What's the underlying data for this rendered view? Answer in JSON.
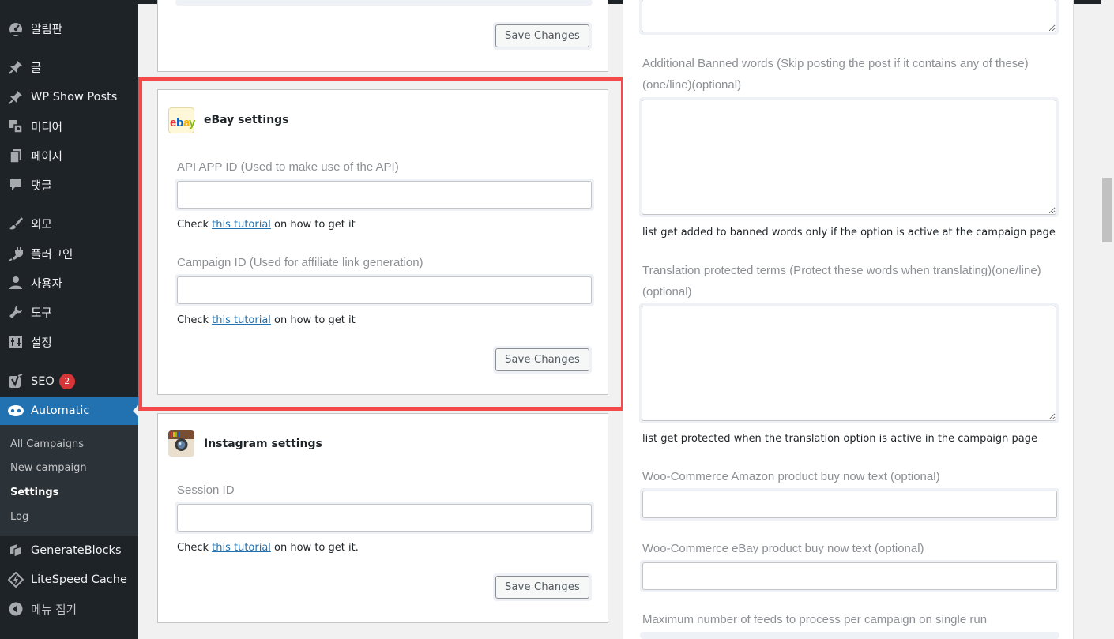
{
  "sidebar": {
    "items": [
      {
        "label": "알림판",
        "icon": "dashboard-icon"
      },
      {
        "label": "글",
        "icon": "pin-icon"
      },
      {
        "label": "WP Show Posts",
        "icon": "pin-icon"
      },
      {
        "label": "미디어",
        "icon": "media-icon"
      },
      {
        "label": "페이지",
        "icon": "page-icon"
      },
      {
        "label": "댓글",
        "icon": "comment-icon"
      },
      {
        "label": "외모",
        "icon": "brush-icon"
      },
      {
        "label": "플러그인",
        "icon": "plugin-icon"
      },
      {
        "label": "사용자",
        "icon": "user-icon"
      },
      {
        "label": "도구",
        "icon": "wrench-icon"
      },
      {
        "label": "설정",
        "icon": "settings-icon"
      },
      {
        "label": "SEO",
        "icon": "yoast-icon",
        "badge": "2"
      },
      {
        "label": "Automatic",
        "icon": "automatic-icon",
        "active": true
      },
      {
        "label": "GenerateBlocks",
        "icon": "generateblocks-icon"
      },
      {
        "label": "LiteSpeed Cache",
        "icon": "litespeed-icon"
      },
      {
        "label": "메뉴 접기",
        "icon": "collapse-icon"
      }
    ],
    "submenu": [
      "All Campaigns",
      "New campaign",
      "Settings",
      "Log"
    ]
  },
  "top_panel": {
    "save_label": "Save Changes"
  },
  "ebay": {
    "title": "eBay settings",
    "api_label": "API APP ID (Used to make use of the API)",
    "api_value": "",
    "help_prefix": "Check ",
    "help_link": "this tutorial",
    "help_suffix": " on how to get it",
    "campaign_label": "Campaign ID (Used for affiliate link generation)",
    "campaign_value": "",
    "save_label": "Save Changes"
  },
  "instagram": {
    "title": "Instagram settings",
    "session_label": "Session ID",
    "session_value": "",
    "help_prefix": "Check ",
    "help_link": "this tutorial",
    "help_suffix": " on how to get it.",
    "save_label": "Save Changes"
  },
  "right": {
    "banned_label_1": "Additional Banned words (Skip posting the post if it contains any of these)",
    "banned_label_2": "(one/line)(optional)",
    "banned_help": "list get added to banned words only if the option is active at the campaign page",
    "translation_label_1": "Translation protected terms (Protect these words when translating)(one/line)",
    "translation_label_2": "(optional)",
    "translation_help": "list get protected when the translation option is active in the campaign page",
    "woo_amazon_label": "Woo-Commerce Amazon product buy now text (optional)",
    "woo_ebay_label": "Woo-Commerce eBay product buy now text (optional)",
    "max_feeds_label": "Maximum number of feeds to process per campaign on single run"
  },
  "colors": {
    "sidebar_bg": "#1d2327",
    "accent": "#2271b1",
    "highlight": "#f44a4a",
    "badge": "#d63638"
  }
}
